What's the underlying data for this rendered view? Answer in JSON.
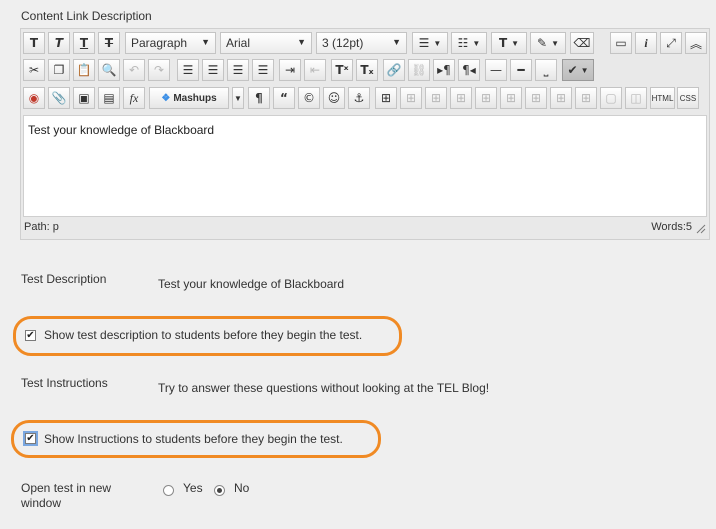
{
  "editor": {
    "label": "Content Link Description",
    "paragraph_format": "Paragraph",
    "font_family": "Arial",
    "font_size": "3 (12pt)",
    "mashups": "Mashups",
    "html_label": "HTML",
    "css_label": "CSS",
    "content": "Test your knowledge of Blackboard",
    "path": "Path: p",
    "words": "Words:5"
  },
  "test_description": {
    "label": "Test Description",
    "value": "Test your knowledge of Blackboard",
    "checkbox_label": "Show test description to students before they begin the test."
  },
  "test_instructions": {
    "label": "Test Instructions",
    "value": "Try to answer these questions without looking at the TEL Blog!",
    "checkbox_label": "Show Instructions to students before they begin the test."
  },
  "open_new_window": {
    "label_line1": "Open test in new",
    "label_line2": "window",
    "yes": "Yes",
    "no": "No",
    "selected": "No"
  },
  "colors": {
    "highlight": "#f08a24"
  }
}
